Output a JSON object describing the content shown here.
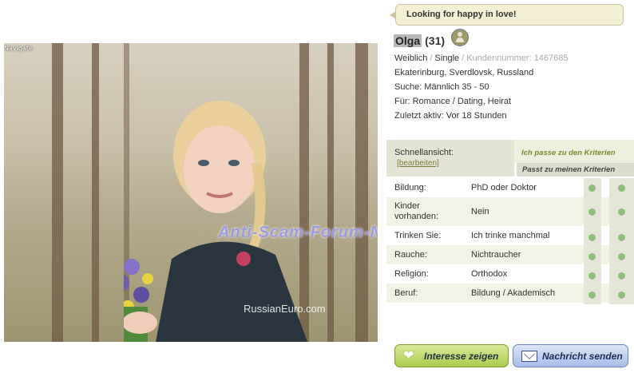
{
  "status_message": "Looking for happy in love!",
  "profile": {
    "name": "Olga",
    "age": "(31)",
    "gender": "Weiblich",
    "status": "Single",
    "customer_number_label": "Kundennummer:",
    "customer_number": "1467685",
    "location": "Ekaterinburg, Sverdlovsk, Russland",
    "search": "Suche: Männlich 35 - 50",
    "for": "Für: Romance / Dating, Heirat",
    "last_active": "Zuletzt aktiv: Vor 18 Stunden"
  },
  "photo": {
    "watermark_site": "RussianEuro.com",
    "watermark_forum": "Anti-Scam-Forum-NL",
    "corner_tag": "Navigate"
  },
  "criteria": {
    "quickview_label": "Schnellansicht:",
    "edit_link": "[bearbeiten]",
    "legend_i_match": "Ich passe zu den Kriterien",
    "legend_matches_me": "Passt zu meinen Kriterien",
    "rows": [
      {
        "label": "Bildung:",
        "value": "PhD oder Doktor"
      },
      {
        "label": "Kinder vorhanden:",
        "value": "Nein"
      },
      {
        "label": "Trinken Sie:",
        "value": "Ich trinke manchmal"
      },
      {
        "label": "Rauche:",
        "value": "Nichtraucher"
      },
      {
        "label": "Religion:",
        "value": "Orthodox"
      },
      {
        "label": "Beruf:",
        "value": "Bildung / Akademisch"
      }
    ]
  },
  "buttons": {
    "interest": "Interesse zeigen",
    "message": "Nachricht senden"
  },
  "colors": {
    "bubble_bg": "#f3f0d3",
    "match_dot": "#8fbf7a",
    "interest_button": "#aacb4c",
    "message_button": "#a9bde7"
  }
}
